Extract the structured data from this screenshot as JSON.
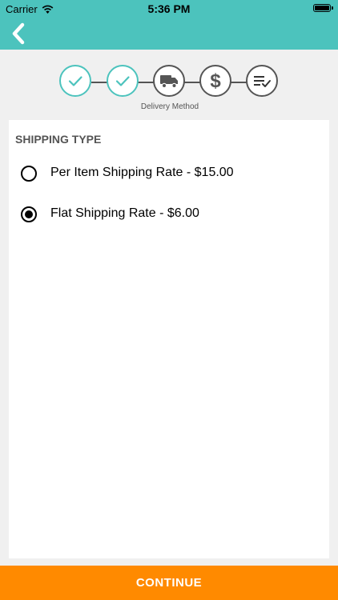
{
  "status_bar": {
    "carrier": "Carrier",
    "time": "5:36 PM"
  },
  "nav": {
    "back_icon": "chevron-left-icon"
  },
  "stepper": {
    "caption": "Delivery Method",
    "steps": [
      {
        "icon": "check-icon",
        "state": "done"
      },
      {
        "icon": "check-icon",
        "state": "done"
      },
      {
        "icon": "truck-icon",
        "state": "current"
      },
      {
        "icon": "dollar-icon",
        "state": "todo"
      },
      {
        "icon": "checklist-icon",
        "state": "todo"
      }
    ]
  },
  "shipping": {
    "title": "SHIPPING TYPE",
    "options": [
      {
        "label": "Per Item Shipping Rate - $15.00",
        "selected": false
      },
      {
        "label": "Flat Shipping Rate - $6.00",
        "selected": true
      }
    ]
  },
  "footer": {
    "continue_label": "CONTINUE"
  },
  "colors": {
    "accent": "#4cc3bd",
    "button": "#ff8a00",
    "inactive": "#555555"
  }
}
